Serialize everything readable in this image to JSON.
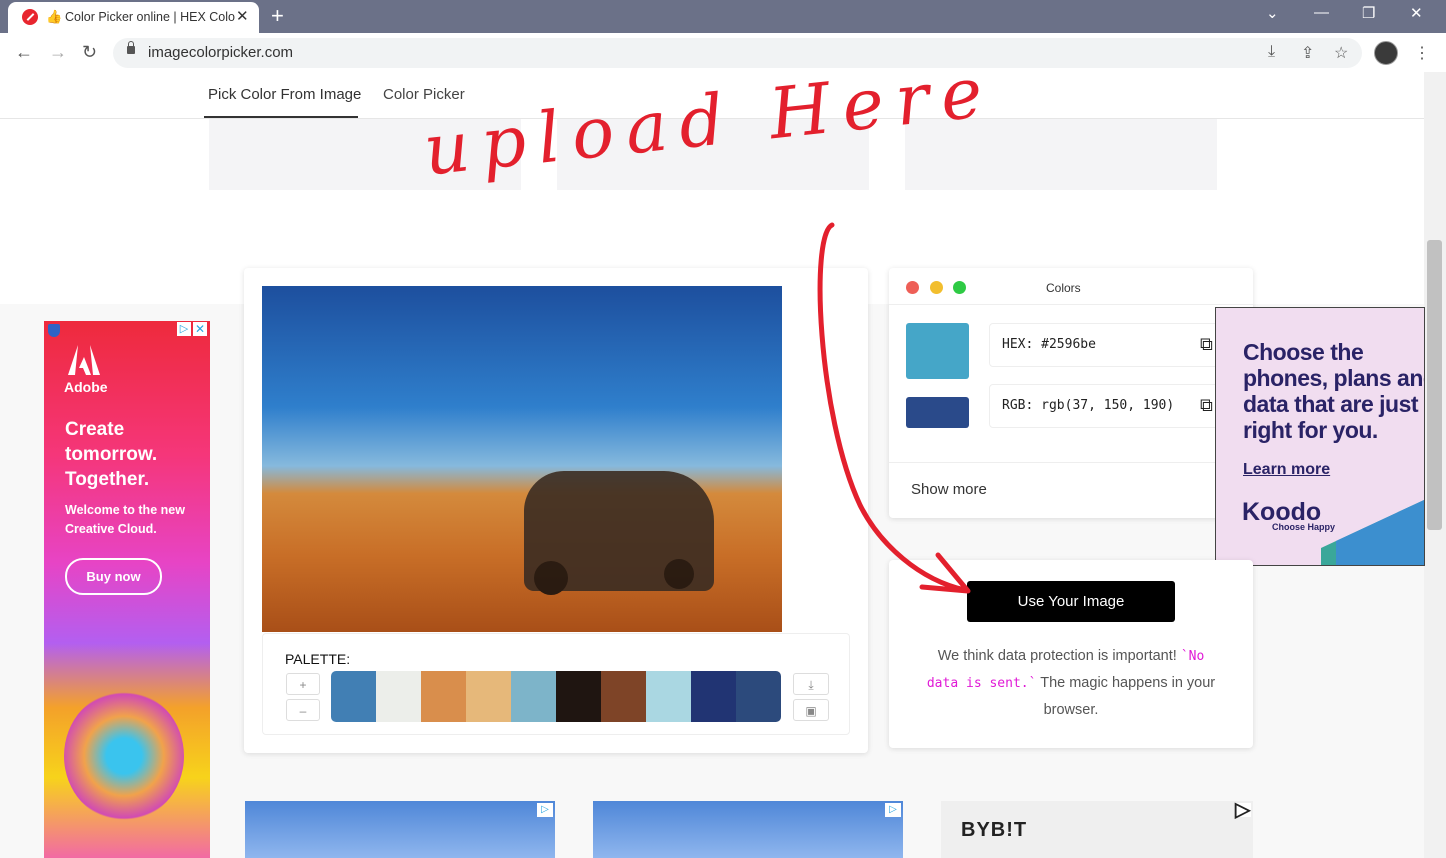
{
  "browser": {
    "tab_title": "Color Picker online | HEX Color",
    "tab_close": "✕",
    "new_tab": "+",
    "url": "imagecolorpicker.com",
    "window_controls": [
      "⌄",
      "—",
      "❐",
      "✕"
    ],
    "nav_icons": [
      "back-icon",
      "forward-icon",
      "reload-icon"
    ],
    "toolbar_icons": [
      "install-icon",
      "share-icon",
      "bookmark-star-icon",
      "profile-avatar",
      "menu-icon"
    ]
  },
  "site_nav": {
    "tabs": [
      {
        "label": "Pick Color From Image",
        "active": true
      },
      {
        "label": "Color Picker",
        "active": false
      }
    ]
  },
  "annotation": {
    "text": "upload Here",
    "color": "#e3202d"
  },
  "adobe_ad": {
    "brand": "Adobe",
    "headline": "Create tomorrow. Together.",
    "subtext": "Welcome to the new Creative Cloud.",
    "cta": "Buy now",
    "adchoices": "▷",
    "close": "✕"
  },
  "palette": {
    "label": "PALETTE:",
    "zoom_in": "+",
    "zoom_out": "–",
    "swatches": [
      "#417fb4",
      "#eceeea",
      "#d98e4c",
      "#e6b87a",
      "#7db4c9",
      "#1f1511",
      "#7e4427",
      "#aad7e2",
      "#213473",
      "#2c4a7c"
    ],
    "download_icon": "⤓",
    "save_icon": "▣"
  },
  "colors_panel": {
    "title": "Colors",
    "traffic_lights": [
      "#ee5f57",
      "#f2be2e",
      "#2eca44"
    ],
    "primary_color": "#2596be",
    "secondary_color": "#2a4a8a",
    "hex_value": "HEX: #2596be",
    "rgb_value": "RGB: rgb(37, 150, 190)",
    "copy_icon": "⧉",
    "show_more": "Show more"
  },
  "koodo_ad": {
    "headline": "Choose the phones, plans and data that are just right for you.",
    "learn_more": "Learn more",
    "logo": "Koodo",
    "tagline": "Choose Happy"
  },
  "upload_panel": {
    "button": "Use Your Image",
    "privacy_before": "We think data protection is important!",
    "privacy_code": "`No data is sent.`",
    "privacy_after": "The magic happens in your browser."
  },
  "bottom_ads": {
    "bybit_logo": "BYB!T",
    "adchoices": "▷"
  }
}
